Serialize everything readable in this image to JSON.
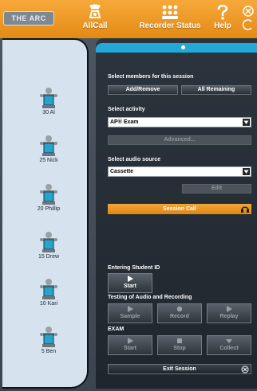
{
  "toolbar": {
    "logo": "THE ARC",
    "allcall_label": "AllCall",
    "recorder_status_label": "Recorder Status",
    "help_label": "Help"
  },
  "students": [
    {
      "name": "30 Al"
    },
    {
      "name": "25 Nick"
    },
    {
      "name": "20 Phillip"
    },
    {
      "name": "15 Drew"
    },
    {
      "name": "10 Kari"
    },
    {
      "name": "5 Ben"
    }
  ],
  "session": {
    "select_members_label": "Select members for this session",
    "add_remove_label": "Add/Remove",
    "all_remaining_label": "All Remaining",
    "select_activity_label": "Select activity",
    "activity_value": "AP® Exam",
    "advanced_label": "Advanced...",
    "select_audio_label": "Select audio source",
    "audio_value": "Cassette",
    "edit_label": "Edit",
    "session_call_label": "Session Call",
    "entering_id_label": "Entering Student ID",
    "entering_start_label": "Start",
    "testing_label": "Testing of Audio and Recording",
    "sample_label": "Sample",
    "record_label": "Record",
    "replay_label": "Replay",
    "exam_label": "EXAM",
    "exam_start_label": "Start",
    "stop_label": "Stop",
    "collect_label": "Collect",
    "exit_label": "Exit Session"
  },
  "colors": {
    "toolbar_orange": "#e48a15",
    "student_panel": "#d6e3ee",
    "accent_blue": "#22a9d8",
    "session_call_orange": "#f3a635"
  }
}
